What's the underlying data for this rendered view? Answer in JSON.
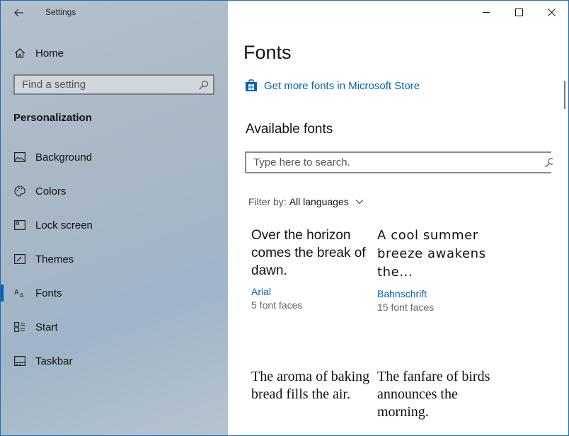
{
  "window": {
    "title": "Settings"
  },
  "sidebar": {
    "home_label": "Home",
    "search_placeholder": "Find a setting",
    "section_heading": "Personalization",
    "items": [
      {
        "label": "Background",
        "icon": "picture-icon",
        "active": false
      },
      {
        "label": "Colors",
        "icon": "palette-icon",
        "active": false
      },
      {
        "label": "Lock screen",
        "icon": "lock-screen-icon",
        "active": false
      },
      {
        "label": "Themes",
        "icon": "brush-icon",
        "active": false
      },
      {
        "label": "Fonts",
        "icon": "font-icon",
        "active": true
      },
      {
        "label": "Start",
        "icon": "start-icon",
        "active": false
      },
      {
        "label": "Taskbar",
        "icon": "taskbar-icon",
        "active": false
      }
    ]
  },
  "main": {
    "title": "Fonts",
    "store_link": "Get more fonts in Microsoft Store",
    "section_title": "Available fonts",
    "search_placeholder": "Type here to search.",
    "filter_label": "Filter by:",
    "filter_value": "All languages",
    "fonts": [
      {
        "sample": "Over the horizon comes the break of dawn.",
        "name": "Arial",
        "faces": "5 font faces"
      },
      {
        "sample": "A cool summer breeze awakens the...",
        "name": "Bahnschrift",
        "faces": "15 font faces"
      },
      {
        "sample": "The aroma of baking bread fills the air.",
        "name": "",
        "faces": ""
      },
      {
        "sample": "The fanfare of birds announces the morning.",
        "name": "",
        "faces": ""
      }
    ]
  },
  "colors": {
    "accent": "#0063b1",
    "window_border": "#1f6bb7"
  }
}
